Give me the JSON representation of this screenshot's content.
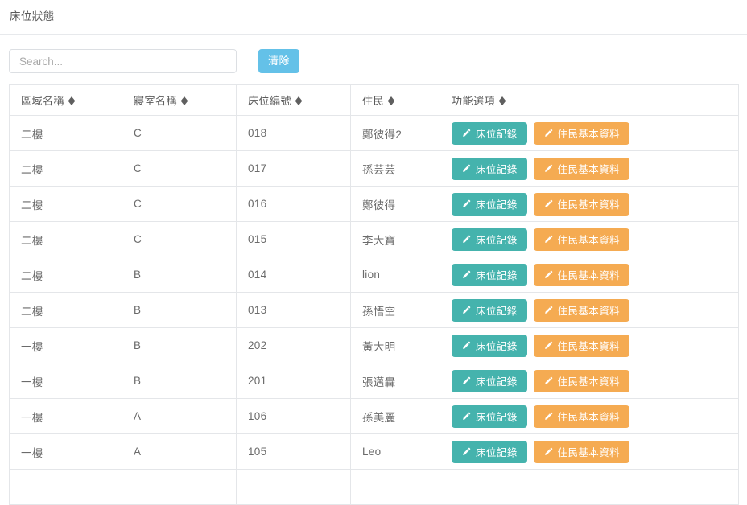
{
  "header": {
    "title": "床位狀態"
  },
  "toolbar": {
    "search": {
      "placeholder": "Search...",
      "value": ""
    },
    "clear_label": "清除"
  },
  "table": {
    "columns": [
      {
        "label": "區域名稱",
        "sort_icon": "sort-both-icon"
      },
      {
        "label": "寢室名稱",
        "sort_icon": "sort-both-icon"
      },
      {
        "label": "床位編號",
        "sort_icon": "sort-both-icon"
      },
      {
        "label": "住民",
        "sort_icon": "sort-both-icon"
      },
      {
        "label": "功能選項",
        "sort_icon": "sort-both-icon"
      }
    ],
    "actions": {
      "bed_record_label": "床位記錄",
      "resident_info_label": "住民基本資料",
      "icon": "pencil-icon"
    },
    "rows": [
      {
        "zone": "二樓",
        "room": "C",
        "bed": "018",
        "resident": "鄭彼得2"
      },
      {
        "zone": "二樓",
        "room": "C",
        "bed": "017",
        "resident": "孫芸芸"
      },
      {
        "zone": "二樓",
        "room": "C",
        "bed": "016",
        "resident": "鄭彼得"
      },
      {
        "zone": "二樓",
        "room": "C",
        "bed": "015",
        "resident": "李大寶"
      },
      {
        "zone": "二樓",
        "room": "B",
        "bed": "014",
        "resident": "lion"
      },
      {
        "zone": "二樓",
        "room": "B",
        "bed": "013",
        "resident": "孫悟空"
      },
      {
        "zone": "一樓",
        "room": "B",
        "bed": "202",
        "resident": "黃大明"
      },
      {
        "zone": "一樓",
        "room": "B",
        "bed": "201",
        "resident": "張邁轟"
      },
      {
        "zone": "一樓",
        "room": "A",
        "bed": "106",
        "resident": "孫美麗"
      },
      {
        "zone": "一樓",
        "room": "A",
        "bed": "105",
        "resident": "Leo"
      },
      {
        "zone": "",
        "room": "",
        "bed": "",
        "resident": ""
      }
    ]
  },
  "colors": {
    "primary": "#45b3ad",
    "warning": "#f5ab52",
    "info": "#64c1e8",
    "border": "#e4e6e9",
    "text": "#6b6b6b"
  }
}
